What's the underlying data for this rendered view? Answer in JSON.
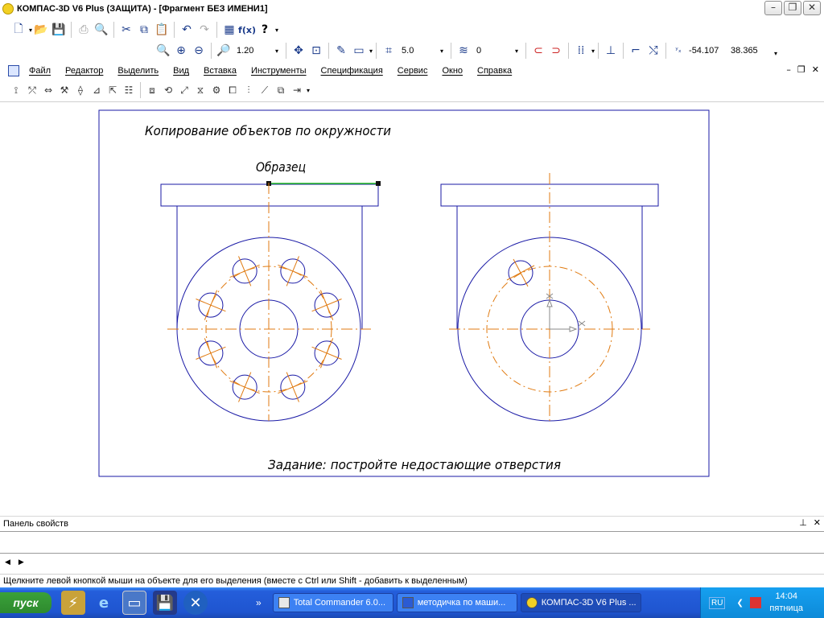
{
  "window": {
    "title": "КОМПАС-3D V6 Plus (ЗАЩИТА) - [Фрагмент БЕЗ ИМЕНИ1]"
  },
  "toolbar": {
    "zoom_value": "1.20",
    "step_value": "5.0",
    "layer_value": "0",
    "coord_x": "-54.107",
    "coord_y": "38.365",
    "fx_label": "f(x)",
    "help_label": "?"
  },
  "menu": {
    "items": [
      "Файл",
      "Редактор",
      "Выделить",
      "Вид",
      "Вставка",
      "Инструменты",
      "Спецификация",
      "Сервис",
      "Окно",
      "Справка"
    ]
  },
  "drawing": {
    "title": "Копирование объектов по окружности",
    "sample_label": "Образец",
    "task_text": "Задание: постройте недостающие отверстия"
  },
  "properties_panel": {
    "label": "Панель свойств"
  },
  "status": {
    "text": "Щелкните левой кнопкой мыши на объекте для его выделения (вместе с Ctrl или Shift - добавить к выделенным)"
  },
  "taskbar": {
    "start_label": "пуск",
    "overflow_label": "»",
    "tasks": [
      "Total Commander 6.0...",
      "методичка по маши...",
      "КОМПАС-3D V6 Plus ..."
    ],
    "language": "RU",
    "time": "14:04",
    "day": "пятница"
  },
  "colors": {
    "outline": "#1a1aa6",
    "axis": "#e07a10",
    "selection": "#22bb22"
  }
}
